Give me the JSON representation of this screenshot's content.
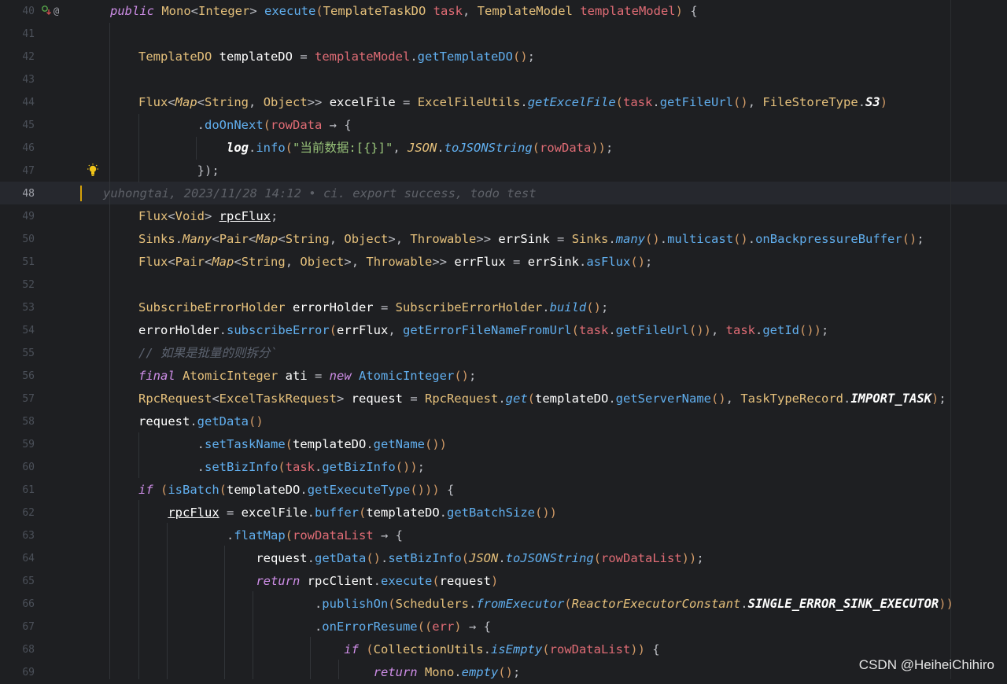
{
  "editor": {
    "lines": [
      {
        "n": "40",
        "code": [
          [
            "kw",
            "public "
          ],
          [
            "ty",
            "Mono"
          ],
          [
            "pl",
            "<"
          ],
          [
            "ty",
            "Integer"
          ],
          [
            "pl",
            "> "
          ],
          [
            "fn",
            "execute"
          ],
          [
            "bk",
            "("
          ],
          [
            "ty",
            "TemplateTaskDO "
          ],
          [
            "pa",
            "task"
          ],
          [
            "pl",
            ", "
          ],
          [
            "ty",
            "TemplateModel "
          ],
          [
            "pa",
            "templateModel"
          ],
          [
            "bk",
            ")"
          ],
          [
            "pl",
            " {"
          ]
        ]
      },
      {
        "n": "41",
        "code": []
      },
      {
        "n": "42",
        "code": [
          [
            "ty",
            "TemplateDO "
          ],
          [
            "var",
            "templateDO"
          ],
          [
            "pl",
            " = "
          ],
          [
            "pa",
            "templateModel"
          ],
          [
            "pl",
            "."
          ],
          [
            "fn",
            "getTemplateDO"
          ],
          [
            "bk",
            "()"
          ],
          [
            "pl",
            ";"
          ]
        ]
      },
      {
        "n": "43",
        "code": []
      },
      {
        "n": "44",
        "code": [
          [
            "ty",
            "Flux"
          ],
          [
            "pl",
            "<"
          ],
          [
            "tyi",
            "Map"
          ],
          [
            "pl",
            "<"
          ],
          [
            "ty",
            "String"
          ],
          [
            "pl",
            ", "
          ],
          [
            "ty",
            "Object"
          ],
          [
            "pl",
            ">> "
          ],
          [
            "var",
            "excelFile"
          ],
          [
            "pl",
            " = "
          ],
          [
            "ty",
            "ExcelFileUtils"
          ],
          [
            "pl",
            "."
          ],
          [
            "fni",
            "getExcelFile"
          ],
          [
            "bk",
            "("
          ],
          [
            "pa",
            "task"
          ],
          [
            "pl",
            "."
          ],
          [
            "fn",
            "getFileUrl"
          ],
          [
            "bk",
            "()"
          ],
          [
            "pl",
            ", "
          ],
          [
            "ty",
            "FileStoreType"
          ],
          [
            "pl",
            "."
          ],
          [
            "sf",
            "S3"
          ],
          [
            "bk",
            ")"
          ]
        ]
      },
      {
        "n": "45",
        "code": [
          [
            "pl",
            "        ."
          ],
          [
            "fn",
            "doOnNext"
          ],
          [
            "bk",
            "("
          ],
          [
            "pa",
            "rowData"
          ],
          [
            "pl",
            " → {"
          ]
        ]
      },
      {
        "n": "46",
        "code": [
          [
            "pl",
            "            "
          ],
          [
            "lg",
            "log"
          ],
          [
            "pl",
            "."
          ],
          [
            "fn",
            "info"
          ],
          [
            "bk",
            "("
          ],
          [
            "st",
            "\"当前数据:[{}]\""
          ],
          [
            "pl",
            ", "
          ],
          [
            "tyi",
            "JSON"
          ],
          [
            "pl",
            "."
          ],
          [
            "fni",
            "toJSONString"
          ],
          [
            "bk",
            "("
          ],
          [
            "pa",
            "rowData"
          ],
          [
            "bk",
            "))"
          ],
          [
            "pl",
            ";"
          ]
        ]
      },
      {
        "n": "47",
        "code": [
          [
            "pl",
            "        "
          ],
          [
            "pl",
            "});"
          ]
        ]
      },
      {
        "n": "48",
        "code": [
          [
            "blame",
            "yuhongtai, 2023/11/28 14:12 • ci. export success, todo test"
          ]
        ]
      },
      {
        "n": "49",
        "code": [
          [
            "ty",
            "Flux"
          ],
          [
            "pl",
            "<"
          ],
          [
            "ty",
            "Void"
          ],
          [
            "pl",
            "> "
          ],
          [
            "ul",
            "rpcFlux"
          ],
          [
            "pl",
            ";"
          ]
        ]
      },
      {
        "n": "50",
        "code": [
          [
            "ty",
            "Sinks"
          ],
          [
            "pl",
            "."
          ],
          [
            "tyi",
            "Many"
          ],
          [
            "pl",
            "<"
          ],
          [
            "ty",
            "Pair"
          ],
          [
            "pl",
            "<"
          ],
          [
            "tyi",
            "Map"
          ],
          [
            "pl",
            "<"
          ],
          [
            "ty",
            "String"
          ],
          [
            "pl",
            ", "
          ],
          [
            "ty",
            "Object"
          ],
          [
            "pl",
            ">, "
          ],
          [
            "ty",
            "Throwable"
          ],
          [
            "pl",
            ">> "
          ],
          [
            "var",
            "errSink"
          ],
          [
            "pl",
            " = "
          ],
          [
            "ty",
            "Sinks"
          ],
          [
            "pl",
            "."
          ],
          [
            "fni",
            "many"
          ],
          [
            "bk",
            "()"
          ],
          [
            "pl",
            "."
          ],
          [
            "fn",
            "multicast"
          ],
          [
            "bk",
            "()"
          ],
          [
            "pl",
            "."
          ],
          [
            "fn",
            "onBackpressureBuffer"
          ],
          [
            "bk",
            "()"
          ],
          [
            "pl",
            ";"
          ]
        ]
      },
      {
        "n": "51",
        "code": [
          [
            "ty",
            "Flux"
          ],
          [
            "pl",
            "<"
          ],
          [
            "ty",
            "Pair"
          ],
          [
            "pl",
            "<"
          ],
          [
            "tyi",
            "Map"
          ],
          [
            "pl",
            "<"
          ],
          [
            "ty",
            "String"
          ],
          [
            "pl",
            ", "
          ],
          [
            "ty",
            "Object"
          ],
          [
            "pl",
            ">, "
          ],
          [
            "ty",
            "Throwable"
          ],
          [
            "pl",
            ">> "
          ],
          [
            "var",
            "errFlux"
          ],
          [
            "pl",
            " = "
          ],
          [
            "var",
            "errSink"
          ],
          [
            "pl",
            "."
          ],
          [
            "fn",
            "asFlux"
          ],
          [
            "bk",
            "()"
          ],
          [
            "pl",
            ";"
          ]
        ]
      },
      {
        "n": "52",
        "code": []
      },
      {
        "n": "53",
        "code": [
          [
            "ty",
            "SubscribeErrorHolder "
          ],
          [
            "var",
            "errorHolder"
          ],
          [
            "pl",
            " = "
          ],
          [
            "ty",
            "SubscribeErrorHolder"
          ],
          [
            "pl",
            "."
          ],
          [
            "fni",
            "build"
          ],
          [
            "bk",
            "()"
          ],
          [
            "pl",
            ";"
          ]
        ]
      },
      {
        "n": "54",
        "code": [
          [
            "var",
            "errorHolder"
          ],
          [
            "pl",
            "."
          ],
          [
            "fn",
            "subscribeError"
          ],
          [
            "bk",
            "("
          ],
          [
            "var",
            "errFlux"
          ],
          [
            "pl",
            ", "
          ],
          [
            "fn",
            "getErrorFileNameFromUrl"
          ],
          [
            "bk",
            "("
          ],
          [
            "pa",
            "task"
          ],
          [
            "pl",
            "."
          ],
          [
            "fn",
            "getFileUrl"
          ],
          [
            "bk",
            "())"
          ],
          [
            "pl",
            ", "
          ],
          [
            "pa",
            "task"
          ],
          [
            "pl",
            "."
          ],
          [
            "fn",
            "getId"
          ],
          [
            "bk",
            "())"
          ],
          [
            "pl",
            ";"
          ]
        ]
      },
      {
        "n": "55",
        "code": [
          [
            "cm",
            "// 如果是批量的则拆分`"
          ]
        ]
      },
      {
        "n": "56",
        "code": [
          [
            "kw",
            "final "
          ],
          [
            "ty",
            "AtomicInteger "
          ],
          [
            "var",
            "ati"
          ],
          [
            "pl",
            " = "
          ],
          [
            "kw",
            "new "
          ],
          [
            "fn",
            "AtomicInteger"
          ],
          [
            "bk",
            "()"
          ],
          [
            "pl",
            ";"
          ]
        ]
      },
      {
        "n": "57",
        "code": [
          [
            "ty",
            "RpcRequest"
          ],
          [
            "pl",
            "<"
          ],
          [
            "ty",
            "ExcelTaskRequest"
          ],
          [
            "pl",
            "> "
          ],
          [
            "var",
            "request"
          ],
          [
            "pl",
            " = "
          ],
          [
            "ty",
            "RpcRequest"
          ],
          [
            "pl",
            "."
          ],
          [
            "fni",
            "get"
          ],
          [
            "bk",
            "("
          ],
          [
            "var",
            "templateDO"
          ],
          [
            "pl",
            "."
          ],
          [
            "fn",
            "getServerName"
          ],
          [
            "bk",
            "()"
          ],
          [
            "pl",
            ", "
          ],
          [
            "ty",
            "TaskTypeRecord"
          ],
          [
            "pl",
            "."
          ],
          [
            "sf",
            "IMPORT_TASK"
          ],
          [
            "bk",
            ")"
          ],
          [
            "pl",
            ";"
          ]
        ]
      },
      {
        "n": "58",
        "code": [
          [
            "var",
            "request"
          ],
          [
            "pl",
            "."
          ],
          [
            "fn",
            "getData"
          ],
          [
            "bk",
            "()"
          ]
        ]
      },
      {
        "n": "59",
        "code": [
          [
            "pl",
            "        ."
          ],
          [
            "fn",
            "setTaskName"
          ],
          [
            "bk",
            "("
          ],
          [
            "var",
            "templateDO"
          ],
          [
            "pl",
            "."
          ],
          [
            "fn",
            "getName"
          ],
          [
            "bk",
            "())"
          ]
        ]
      },
      {
        "n": "60",
        "code": [
          [
            "pl",
            "        ."
          ],
          [
            "fn",
            "setBizInfo"
          ],
          [
            "bk",
            "("
          ],
          [
            "pa",
            "task"
          ],
          [
            "pl",
            "."
          ],
          [
            "fn",
            "getBizInfo"
          ],
          [
            "bk",
            "())"
          ],
          [
            "pl",
            ";"
          ]
        ]
      },
      {
        "n": "61",
        "code": [
          [
            "kw",
            "if "
          ],
          [
            "bk",
            "("
          ],
          [
            "fn",
            "isBatch"
          ],
          [
            "bk",
            "("
          ],
          [
            "var",
            "templateDO"
          ],
          [
            "pl",
            "."
          ],
          [
            "fn",
            "getExecuteType"
          ],
          [
            "bk",
            "()))"
          ],
          [
            "pl",
            " {"
          ]
        ]
      },
      {
        "n": "62",
        "code": [
          [
            "pl",
            "    "
          ],
          [
            "ul",
            "rpcFlux"
          ],
          [
            "pl",
            " = "
          ],
          [
            "var",
            "excelFile"
          ],
          [
            "pl",
            "."
          ],
          [
            "fn",
            "buffer"
          ],
          [
            "bk",
            "("
          ],
          [
            "var",
            "templateDO"
          ],
          [
            "pl",
            "."
          ],
          [
            "fn",
            "getBatchSize"
          ],
          [
            "bk",
            "())"
          ]
        ]
      },
      {
        "n": "63",
        "code": [
          [
            "pl",
            "            ."
          ],
          [
            "fn",
            "flatMap"
          ],
          [
            "bk",
            "("
          ],
          [
            "pa",
            "rowDataList"
          ],
          [
            "pl",
            " → {"
          ]
        ]
      },
      {
        "n": "64",
        "code": [
          [
            "pl",
            "                "
          ],
          [
            "var",
            "request"
          ],
          [
            "pl",
            "."
          ],
          [
            "fn",
            "getData"
          ],
          [
            "bk",
            "()"
          ],
          [
            "pl",
            "."
          ],
          [
            "fn",
            "setBizInfo"
          ],
          [
            "bk",
            "("
          ],
          [
            "tyi",
            "JSON"
          ],
          [
            "pl",
            "."
          ],
          [
            "fni",
            "toJSONString"
          ],
          [
            "bk",
            "("
          ],
          [
            "pa",
            "rowDataList"
          ],
          [
            "bk",
            "))"
          ],
          [
            "pl",
            ";"
          ]
        ]
      },
      {
        "n": "65",
        "code": [
          [
            "pl",
            "                "
          ],
          [
            "kw",
            "return "
          ],
          [
            "var",
            "rpcClient"
          ],
          [
            "pl",
            "."
          ],
          [
            "fn",
            "execute"
          ],
          [
            "bk",
            "("
          ],
          [
            "var",
            "request"
          ],
          [
            "bk",
            ")"
          ]
        ]
      },
      {
        "n": "66",
        "code": [
          [
            "pl",
            "                        ."
          ],
          [
            "fn",
            "publishOn"
          ],
          [
            "bk",
            "("
          ],
          [
            "ty",
            "Schedulers"
          ],
          [
            "pl",
            "."
          ],
          [
            "fni",
            "fromExecutor"
          ],
          [
            "bk",
            "("
          ],
          [
            "tyi",
            "ReactorExecutorConstant"
          ],
          [
            "pl",
            "."
          ],
          [
            "sf",
            "SINGLE_ERROR_SINK_EXECUTOR"
          ],
          [
            "bk",
            "))"
          ]
        ]
      },
      {
        "n": "67",
        "code": [
          [
            "pl",
            "                        ."
          ],
          [
            "fn",
            "onErrorResume"
          ],
          [
            "bk",
            "(("
          ],
          [
            "pa",
            "err"
          ],
          [
            "bk",
            ")"
          ],
          [
            "pl",
            " → {"
          ]
        ]
      },
      {
        "n": "68",
        "code": [
          [
            "pl",
            "                            "
          ],
          [
            "kw",
            "if "
          ],
          [
            "bk",
            "("
          ],
          [
            "ty",
            "CollectionUtils"
          ],
          [
            "pl",
            "."
          ],
          [
            "fni",
            "isEmpty"
          ],
          [
            "bk",
            "("
          ],
          [
            "pa",
            "rowDataList"
          ],
          [
            "bk",
            "))"
          ],
          [
            "pl",
            " {"
          ]
        ]
      },
      {
        "n": "69",
        "code": [
          [
            "pl",
            "                                "
          ],
          [
            "kw",
            "return "
          ],
          [
            "ty",
            "Mono"
          ],
          [
            "pl",
            "."
          ],
          [
            "fni",
            "empty"
          ],
          [
            "bk",
            "()"
          ],
          [
            "pl",
            ";"
          ]
        ]
      }
    ]
  },
  "gutter_icons": {
    "implement": "ⓘ↓",
    "at": "@"
  },
  "watermark": "CSDN @HeiheiChihiro"
}
